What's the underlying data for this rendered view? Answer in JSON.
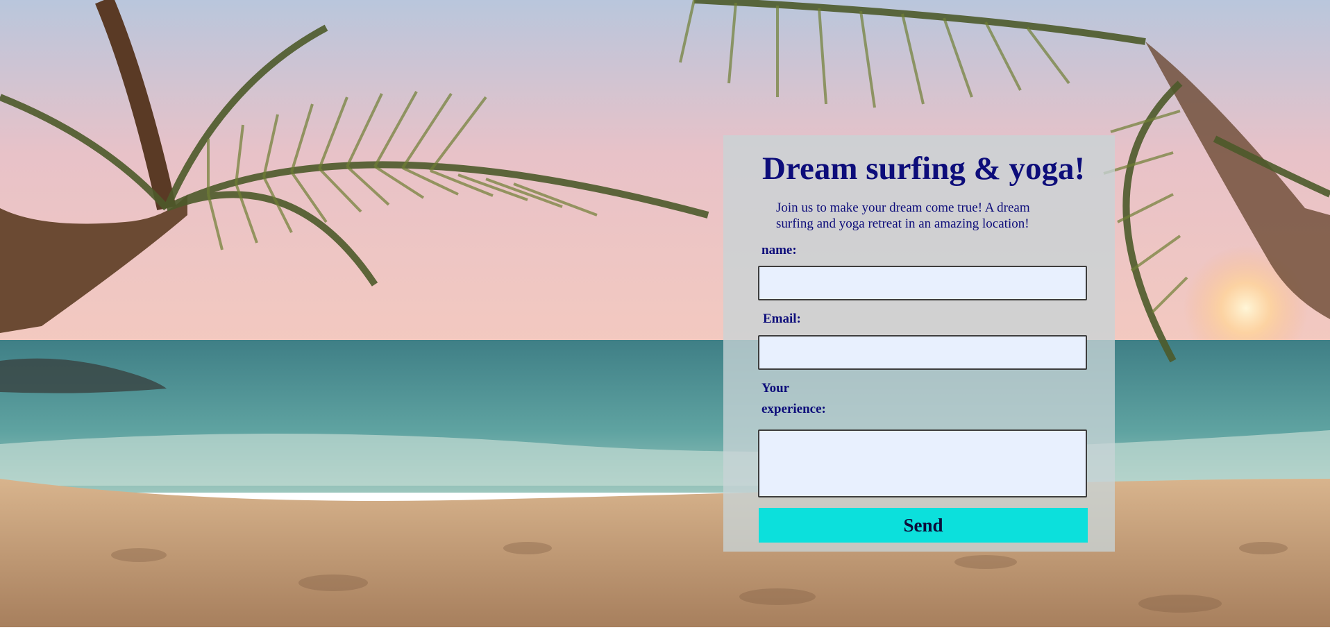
{
  "form": {
    "title": "Dream surfing & yoga!",
    "intro": "Join us to make your dream come true! A dream surfing and yoga retreat in an amazing location!",
    "name_label": "name:",
    "name_value": "",
    "email_label": "Email:",
    "email_value": "",
    "experience_label": "Your experience:",
    "experience_value": "",
    "send_label": "Send"
  },
  "colors": {
    "title_text": "#0d0d7a",
    "input_background": "#e8f0fe",
    "send_button": "#0ce0dc",
    "panel_background": "rgba(200, 212, 214, 0.78)"
  },
  "background": {
    "scene": "tropical-beach-sunset-with-palm-trees"
  }
}
